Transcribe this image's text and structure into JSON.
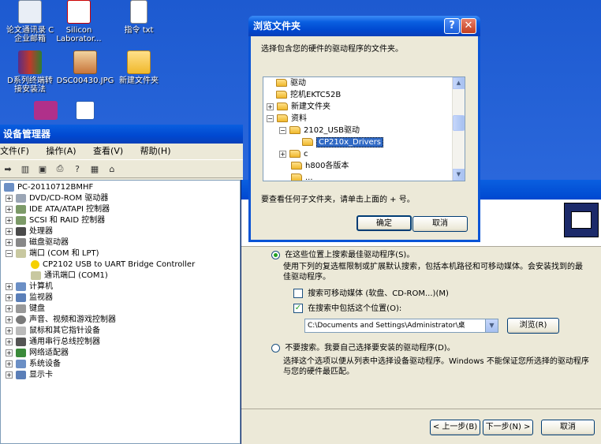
{
  "desktop": {
    "icons": [
      {
        "label": "论文通讯录 C\n企业邮箱"
      },
      {
        "label": "Silicon\nLaborator..."
      },
      {
        "label": "指令 txt"
      },
      {
        "label": "D系列终端转\n接安装法"
      },
      {
        "label": "DSC00430.JPG"
      },
      {
        "label": "新建文件夹"
      }
    ]
  },
  "device_manager": {
    "title": "设备管理器",
    "menu": [
      "文件(F)",
      "操作(A)",
      "查看(V)",
      "帮助(H)"
    ],
    "tree": [
      {
        "label": "PC-20110712BMHF"
      },
      {
        "label": "DVD/CD-ROM 驱动器"
      },
      {
        "label": "IDE ATA/ATAPI 控制器"
      },
      {
        "label": "SCSI 和 RAID 控制器"
      },
      {
        "label": "处理器"
      },
      {
        "label": "磁盘驱动器"
      },
      {
        "label": "端口 (COM 和 LPT)"
      },
      {
        "label": "CP2102 USB to UART Bridge Controller"
      },
      {
        "label": "通讯端口 (COM1)"
      },
      {
        "label": "计算机"
      },
      {
        "label": "监视器"
      },
      {
        "label": "键盘"
      },
      {
        "label": "声音、视频和游戏控制器"
      },
      {
        "label": "鼠标和其它指针设备"
      },
      {
        "label": "通用串行总线控制器"
      },
      {
        "label": "网络适配器"
      },
      {
        "label": "系统设备"
      },
      {
        "label": "显示卡"
      }
    ]
  },
  "browse_dialog": {
    "title": "浏览文件夹",
    "help_btn": "?",
    "close_btn": "✕",
    "instruction": "选择包含您的硬件的驱动程序的文件夹。",
    "tree": [
      {
        "label": "驱动",
        "expander": ""
      },
      {
        "label": "挖机EKTC52B",
        "expander": ""
      },
      {
        "label": "新建文件夹",
        "expander": "+"
      },
      {
        "label": "资料",
        "expander": "−"
      },
      {
        "label": "2102_USB驱动",
        "expander": "−"
      },
      {
        "label": "CP210x_Drivers",
        "expander": ""
      },
      {
        "label": "c",
        "expander": "+"
      },
      {
        "label": "h800各版本",
        "expander": ""
      },
      {
        "label": "...",
        "expander": ""
      }
    ],
    "hint": "要查看任何子文件夹，请单击上面的 + 号。",
    "ok": "确定",
    "cancel": "取消"
  },
  "wizard": {
    "option_search": "在这些位置上搜索最佳驱动程序(S)。",
    "option_search_desc": "使用下列的复选框限制或扩展默认搜索，包括本机路径和可移动媒体。会安装找到的最佳驱动程序。",
    "chk_removable": "搜索可移动媒体 (软盘、CD-ROM...)(M)",
    "chk_location": "在搜索中包括这个位置(O):",
    "location_value": "C:\\Documents and Settings\\Administrator\\桌",
    "browse": "浏览(R)",
    "option_nosearch": "不要搜索。我要自己选择要安装的驱动程序(D)。",
    "option_nosearch_desc": "选择这个选项以便从列表中选择设备驱动程序。Windows 不能保证您所选择的驱动程序与您的硬件最匹配。",
    "back": "< 上一步(B)",
    "next": "下一步(N) >",
    "cancel": "取消"
  }
}
